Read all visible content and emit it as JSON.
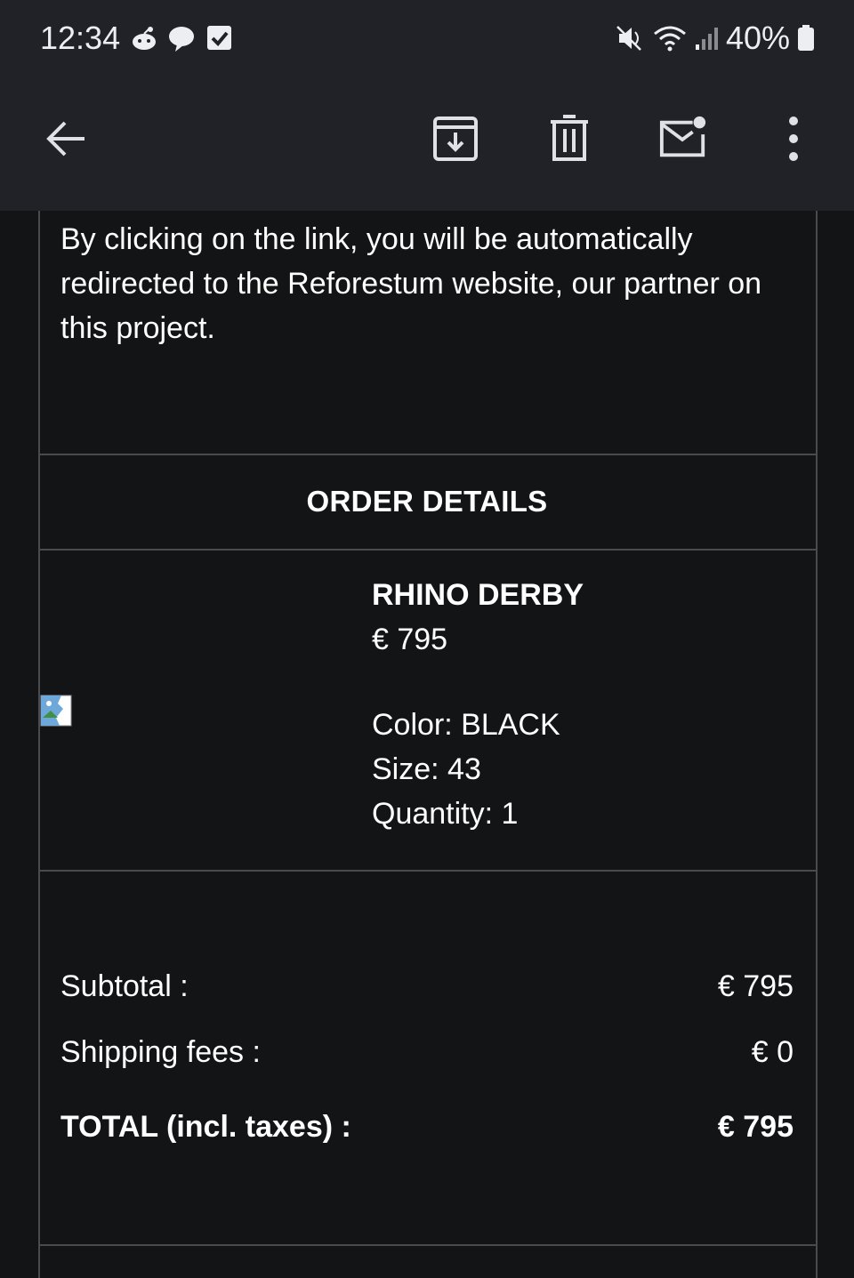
{
  "status_bar": {
    "time": "12:34",
    "left_icons": [
      "reddit-icon",
      "chat-bubble-icon",
      "checkbox-icon"
    ],
    "right_icons": [
      "mute-icon",
      "wifi-icon",
      "signal-icon",
      "battery-icon"
    ],
    "battery": "40%"
  },
  "toolbar": {
    "buttons": [
      "back",
      "archive",
      "delete",
      "mark-unread",
      "more"
    ]
  },
  "email": {
    "intro_text": "By clicking on the link, you will be automatically redirected to the Reforestum website, our partner on this project.",
    "order_title": "ORDER DETAILS",
    "product": {
      "name": "RHINO DERBY",
      "price": "€ 795",
      "color": "Color: BLACK",
      "size": "Size: 43",
      "quantity": "Quantity: 1"
    },
    "summary": {
      "subtotal_label": "Subtotal :",
      "subtotal_value": "€ 795",
      "shipping_label": "Shipping fees :",
      "shipping_value": "€ 0",
      "total_label": "TOTAL (incl. taxes) :",
      "total_value": "€ 795"
    }
  },
  "colors": {
    "background": "#131416",
    "bar": "#202227",
    "border": "#4a4b4e",
    "text": "#ffffff"
  }
}
